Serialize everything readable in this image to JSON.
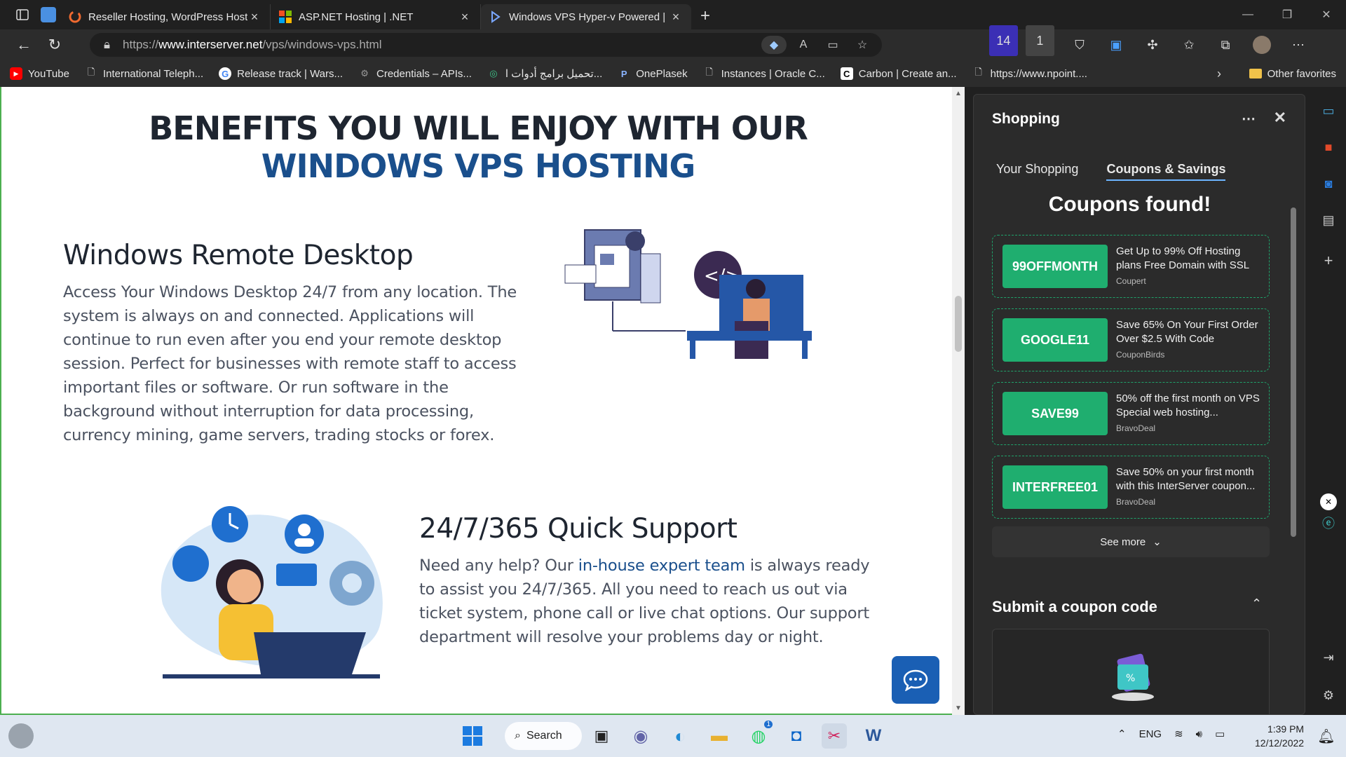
{
  "tabs": [
    {
      "title": "Reseller Hosting, WordPress Host",
      "active": false
    },
    {
      "title": "ASP.NET Hosting | .NET",
      "active": false
    },
    {
      "title": "Windows VPS Hyper-v Powered |",
      "active": true
    }
  ],
  "address": {
    "prefix": "https://",
    "host": "www.interserver.net",
    "path": "/vps/windows-vps.html"
  },
  "extension_badges": {
    "ext1": "14",
    "ext2": "1"
  },
  "favorites": [
    {
      "label": "YouTube",
      "icon": "youtube-icon"
    },
    {
      "label": "International Teleph...",
      "icon": "page-icon"
    },
    {
      "label": "Release track | Wars...",
      "icon": "google-icon"
    },
    {
      "label": "Credentials – APIs...",
      "icon": "gear-icon"
    },
    {
      "label": "تحميل برامج أدوات ا...",
      "icon": "circle-icon"
    },
    {
      "label": "OnePlasek",
      "icon": "p-icon"
    },
    {
      "label": "Instances | Oracle C...",
      "icon": "page-icon"
    },
    {
      "label": "Carbon | Create an...",
      "icon": "carbon-icon"
    },
    {
      "label": "https://www.npoint....",
      "icon": "page-icon"
    }
  ],
  "other_favorites": "Other favorites",
  "page": {
    "heading_line1": "BENEFITS YOU WILL ENJOY WITH OUR",
    "heading_line2": "WINDOWS VPS HOSTING",
    "section1": {
      "title": "Windows Remote Desktop",
      "body": "Access Your Windows Desktop 24/7 from any location. The system is always on and connected. Applications will continue to run even after you end your remote desktop session. Perfect for businesses with remote staff to access important files or software. Or run software in the background without interruption for data processing, currency mining, game servers, trading stocks or forex."
    },
    "section2": {
      "title": "24/7/365 Quick Support",
      "body_before": "Need any help? Our ",
      "link": "in-house expert team",
      "body_after": " is always ready to assist you 24/7/365. All you need to reach us out via ticket system, phone call or live chat options. Our support department will resolve your problems day or night."
    }
  },
  "shopping": {
    "title": "Shopping",
    "tab_your": "Your Shopping",
    "tab_coupons": "Coupons & Savings",
    "found": "Coupons found!",
    "coupons": [
      {
        "code": "99OFFMONTH",
        "desc": "Get Up to 99% Off Hosting plans Free Domain with SSL",
        "source": "Coupert"
      },
      {
        "code": "GOOGLE11",
        "desc": "Save 65% On Your First Order Over $2.5 With Code",
        "source": "CouponBirds"
      },
      {
        "code": "SAVE99",
        "desc": "50% off the first month on VPS Special web hosting...",
        "source": "BravoDeal"
      },
      {
        "code": "INTERFREE01",
        "desc": "Save 50% on your first month with this InterServer coupon...",
        "source": "BravoDeal"
      }
    ],
    "see_more": "See more",
    "submit_title": "Submit a coupon code"
  },
  "taskbar": {
    "search": "Search",
    "lang": "ENG",
    "time": "1:39 PM",
    "date": "12/12/2022",
    "whatsapp_badge": "1"
  },
  "colors": {
    "accent_green": "#1fae6f",
    "heading_blue": "#1a4f8c",
    "chat_blue": "#1a5fb4"
  }
}
